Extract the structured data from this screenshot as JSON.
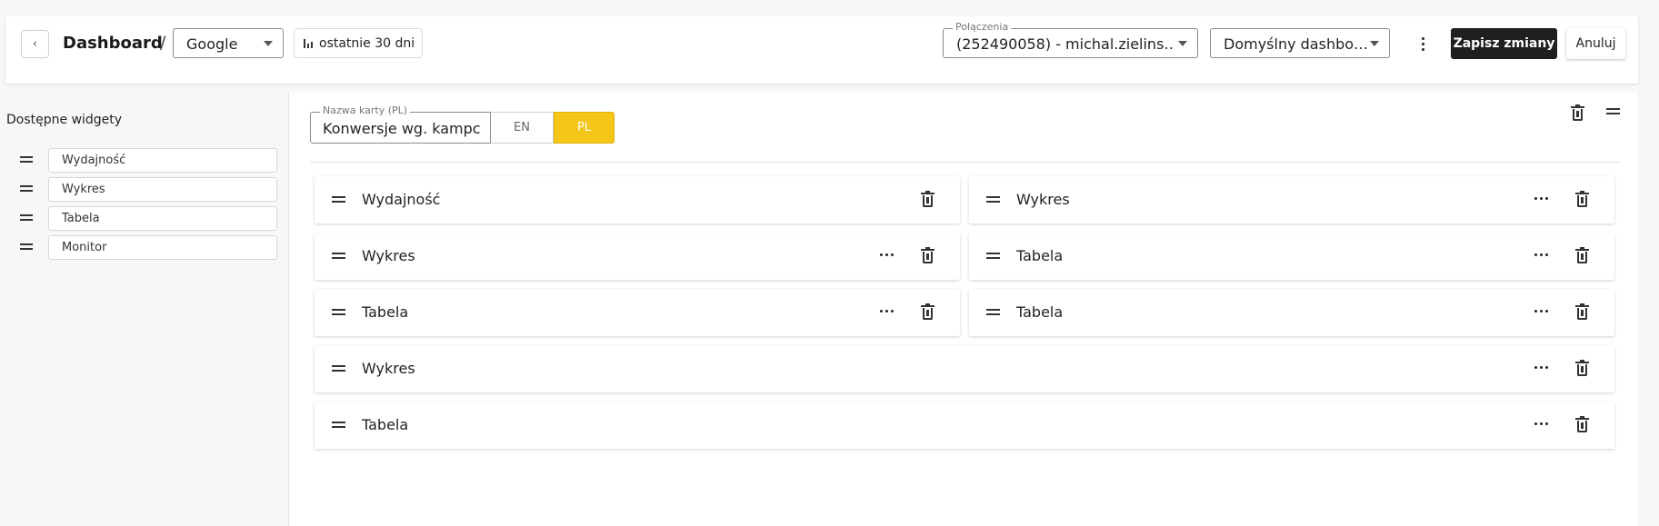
{
  "header": {
    "back_icon": "chevron-left",
    "title": "Dashboard",
    "separator": "/",
    "source_select": "Google",
    "date_range": "ostatnie 30 dni",
    "connections_legend": "Połączenia",
    "connections_value": "(252490058) - michal.zielins…",
    "dashboard_select": "Domyślny dashbo…",
    "save_label": "Zapisz zmiany",
    "cancel_label": "Anuluj"
  },
  "sidebar": {
    "title": "Dostępne widgety",
    "items": [
      {
        "label": "Wydajność"
      },
      {
        "label": "Wykres"
      },
      {
        "label": "Tabela"
      },
      {
        "label": "Monitor"
      }
    ]
  },
  "tab_editor": {
    "name_legend": "Nazwa karty (PL)",
    "name_value": "Konwersje wg. kampc",
    "lang_en": "EN",
    "lang_pl": "PL",
    "active_lang": "PL",
    "accent_color": "#f5c518"
  },
  "widgets": [
    {
      "label": "Wydajność",
      "has_menu": false
    },
    {
      "label": "Wykres",
      "has_menu": true
    },
    {
      "label": "Wykres",
      "has_menu": true
    },
    {
      "label": "Tabela",
      "has_menu": true
    },
    {
      "label": "Tabela",
      "has_menu": true
    },
    {
      "label": "Tabela",
      "has_menu": true
    },
    {
      "label": "Wykres",
      "has_menu": true
    },
    {
      "label": "Tabela",
      "has_menu": true
    }
  ]
}
